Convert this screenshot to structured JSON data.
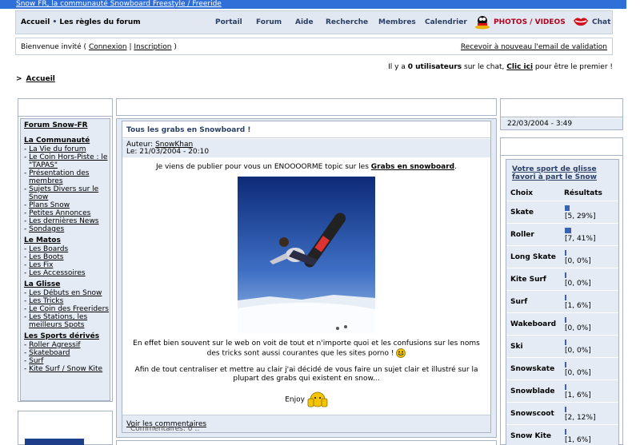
{
  "site": {
    "title": "Snow FR, la communauté Snowboard Freestyle / Freeride"
  },
  "nav": {
    "left": [
      "Accueil",
      "Les règles du forum"
    ],
    "items": [
      "Portail",
      "Forum",
      "Aide",
      "Recherche",
      "Membres",
      "Calendrier"
    ],
    "photos": "PHOTOS / VIDEOS",
    "chat": "Chat"
  },
  "welcome": {
    "prefix": "Bienvenue invité (",
    "login": "Connexion",
    "sep": "|",
    "register": "Inscription",
    "suffix": ")",
    "resend": "Recevoir à nouveau l'email de validation"
  },
  "chatline": {
    "pre": "Il y a",
    "count": "0 utilisateurs",
    "mid": "sur le chat,",
    "link": "Clic ici",
    "post": "pour être le premier !"
  },
  "breadcrumb": {
    "arrow": ">",
    "label": "Accueil"
  },
  "sidebar": {
    "title": "Forum Snow-FR",
    "sections": [
      {
        "name": "La Communauté",
        "links": [
          "La Vie du forum",
          "Le Coin Hors-Piste : le \"TAPAS\"",
          "Présentation des membres",
          "Sujets Divers sur le Snow",
          "Plans Snow",
          "Petites Annonces",
          "Les dernières News",
          "Sondages"
        ]
      },
      {
        "name": "Le Matos",
        "links": [
          "Les Boards",
          "Les Boots",
          "Les Fix",
          "Les Accessoires"
        ]
      },
      {
        "name": "La Glisse",
        "links": [
          "Les Débuts en Snow",
          "Les Tricks",
          "Le Coin des Freeriders",
          "Les Stations, les meilleurs Spots"
        ]
      },
      {
        "name": "Les Sports dérivés",
        "links": [
          "Roller Agressif",
          "Skateboard",
          "Surf",
          "Kite Surf / Snow Kite"
        ]
      }
    ]
  },
  "post": {
    "title": "Tous les grabs en Snowboard !",
    "author_label": "Auteur:",
    "author": "SnowKhan",
    "date": "Le: 21/03/2004 - 20:10",
    "p1_pre": "Je viens de publier pour vous un ENOOOORME topic sur les",
    "p1_link": "Grabs en snowboard",
    "p1_post": ".",
    "p2": "En effet bien souvent sur le web on voit de tout et n'importe quoi et les confusions sur les noms des tricks sont aussi courantes que les sites porno !",
    "p3": "Afin de tout centraliser et mettre au clair j'ai décidé de vous faire un sujet clair et illustré sur la plupart des grabs qui existent en snow...",
    "p4": "Enjoy",
    "comments": "Commentaires: 0 ::",
    "comments_link": "Voir les commentaires"
  },
  "datebox": {
    "date": "22/03/2004 - 3:49"
  },
  "poll": {
    "title": "Votre sport de glisse favori à part le Snow",
    "col_choice": "Choix",
    "col_results": "Résultats",
    "rows": [
      {
        "name": "Skate",
        "result": "[5, 29%]",
        "pct": 29
      },
      {
        "name": "Roller",
        "result": "[7, 41%]",
        "pct": 41
      },
      {
        "name": "Long Skate",
        "result": "[0, 0%]",
        "pct": 0
      },
      {
        "name": "Kite Surf",
        "result": "[0, 0%]",
        "pct": 0
      },
      {
        "name": "Surf",
        "result": "[1, 6%]",
        "pct": 6
      },
      {
        "name": "Wakeboard",
        "result": "[0, 0%]",
        "pct": 0
      },
      {
        "name": "Ski",
        "result": "[0, 0%]",
        "pct": 0
      },
      {
        "name": "Snowskate",
        "result": "[0, 0%]",
        "pct": 0
      },
      {
        "name": "Snowblade",
        "result": "[1, 6%]",
        "pct": 6
      },
      {
        "name": "Snowscoot",
        "result": "[2, 12%]",
        "pct": 12
      },
      {
        "name": "Snow Kite",
        "result": "[1, 6%]",
        "pct": 6
      }
    ]
  },
  "colors": {
    "accent": "#2a3f66",
    "panel": "#e5ebf4",
    "topbar": "#2f6fd8",
    "photos": "#b3001b"
  },
  "icons": [
    "mascot-icon",
    "lips-icon",
    "grin-emoticon-icon",
    "thumbs-up-emoticon-icon"
  ]
}
